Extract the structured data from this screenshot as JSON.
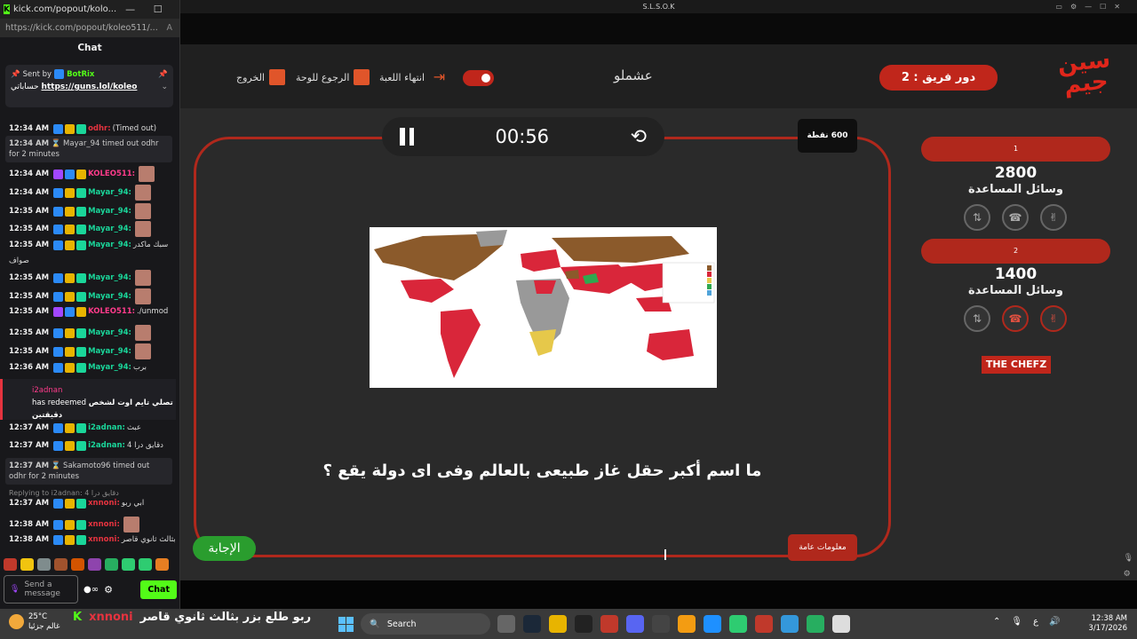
{
  "chat_window": {
    "title": "kick.com/popout/kolo...",
    "url": "https://kick.com/popout/koleo511/...",
    "header": "Chat",
    "pinned": {
      "sent_by_label": "Sent by",
      "sender": "BotRix",
      "text_prefix": "حساباتي",
      "link": "https://guns.lol/koleo"
    },
    "messages": [
      {
        "time": "12:34 AM",
        "user": "odhr",
        "text": "(Timed out)",
        "ucls": "u-r"
      },
      {
        "time": "12:34 AM",
        "user": "KOLEO511",
        "text": "",
        "ucls": "u-p"
      },
      {
        "time": "12:34 AM",
        "user": "Mayar_94",
        "text": "",
        "ucls": "u-y"
      },
      {
        "time": "12:35 AM",
        "user": "Mayar_94",
        "text": "",
        "ucls": "u-y"
      },
      {
        "time": "12:35 AM",
        "user": "Mayar_94",
        "text": "",
        "ucls": "u-y"
      },
      {
        "time": "12:35 AM",
        "user": "Mayar_94",
        "text": "سبك ماكدر",
        "ucls": "u-y"
      },
      {
        "time": "12:35 AM",
        "user": "Mayar_94",
        "text": "",
        "ucls": "u-y"
      },
      {
        "time": "12:35 AM",
        "user": "Mayar_94",
        "text": "",
        "ucls": "u-y"
      },
      {
        "time": "12:35 AM",
        "user": "KOLEO511",
        "text": "./unmod",
        "ucls": "u-p"
      },
      {
        "time": "12:35 AM",
        "user": "Mayar_94",
        "text": "",
        "ucls": "u-y"
      },
      {
        "time": "12:35 AM",
        "user": "Mayar_94",
        "text": "",
        "ucls": "u-y"
      },
      {
        "time": "12:36 AM",
        "user": "Mayar_94",
        "text": "برب",
        "ucls": "u-y"
      },
      {
        "time": "12:37 AM",
        "user": "i2adnan",
        "text": "عبث",
        "ucls": "u-y"
      },
      {
        "time": "12:37 AM",
        "user": "i2adnan",
        "text": "دقايق درا 4",
        "ucls": "u-y"
      },
      {
        "time": "12:37 AM",
        "user": "xnnoni",
        "text": "ابي ربو",
        "ucls": "u-r"
      },
      {
        "time": "12:38 AM",
        "user": "xnnoni",
        "text": "",
        "ucls": "u-r"
      },
      {
        "time": "12:38 AM",
        "user": "xnnoni",
        "text": "ربو طلع بزر بثالث ثانوي قاصر",
        "ucls": "u-r"
      }
    ],
    "sys1": {
      "time": "12:34 AM",
      "text": "Mayar_94 timed out odhr for 2 minutes"
    },
    "sys2": {
      "time": "12:37 AM",
      "text": "Sakamoto96 timed out odhr for 2 minutes"
    },
    "overflow_text": "صواف",
    "redeem": {
      "user": "i2adnan",
      "text": "has redeemed",
      "reward": "تصلي تايم اوت لشخص دقيقتين"
    },
    "reply_hint": "Replying to i2adnan: دقايق درا 4",
    "send_placeholder": "Send a message",
    "chat_button": "Chat"
  },
  "game": {
    "window_title": "S.L.S.O.K",
    "team_turn": "دور فريق : 2",
    "game_name": "عشملو",
    "logo": "سين جيم",
    "nav": {
      "exit": "الخروج",
      "board": "الرجوع للوحة",
      "end": "انتهاء اللعبة"
    },
    "timer": "00:56",
    "points": "600 نقطة",
    "question": "ما اسم أكبر حقل غاز طبيعى بالعالم وفى اى دولة يقع ؟",
    "answer_button": "الإجابة",
    "category": "معلومات عامة",
    "teams": [
      {
        "name": "1",
        "score": "2800",
        "helpers_label": "وسائل المساعدة",
        "used": [
          false,
          false,
          false
        ]
      },
      {
        "name": "2",
        "score": "1400",
        "helpers_label": "وسائل المساعدة",
        "used": [
          false,
          true,
          true
        ]
      }
    ],
    "sponsor": "THE CHEFZ"
  },
  "taskbar": {
    "temp": "25°C",
    "weather_text": "غالم جزئيا",
    "overlay_user": "xnnoni",
    "overlay_text": "ربو طلع بزر بثالث ثانوي قاصر",
    "search": "Search",
    "lang": "ع",
    "time": "12:38 AM",
    "date": "3/17/2026"
  },
  "colors": {
    "kick_green": "#53fc18",
    "game_red": "#b0281c",
    "answer_green": "#2a9d2e"
  }
}
